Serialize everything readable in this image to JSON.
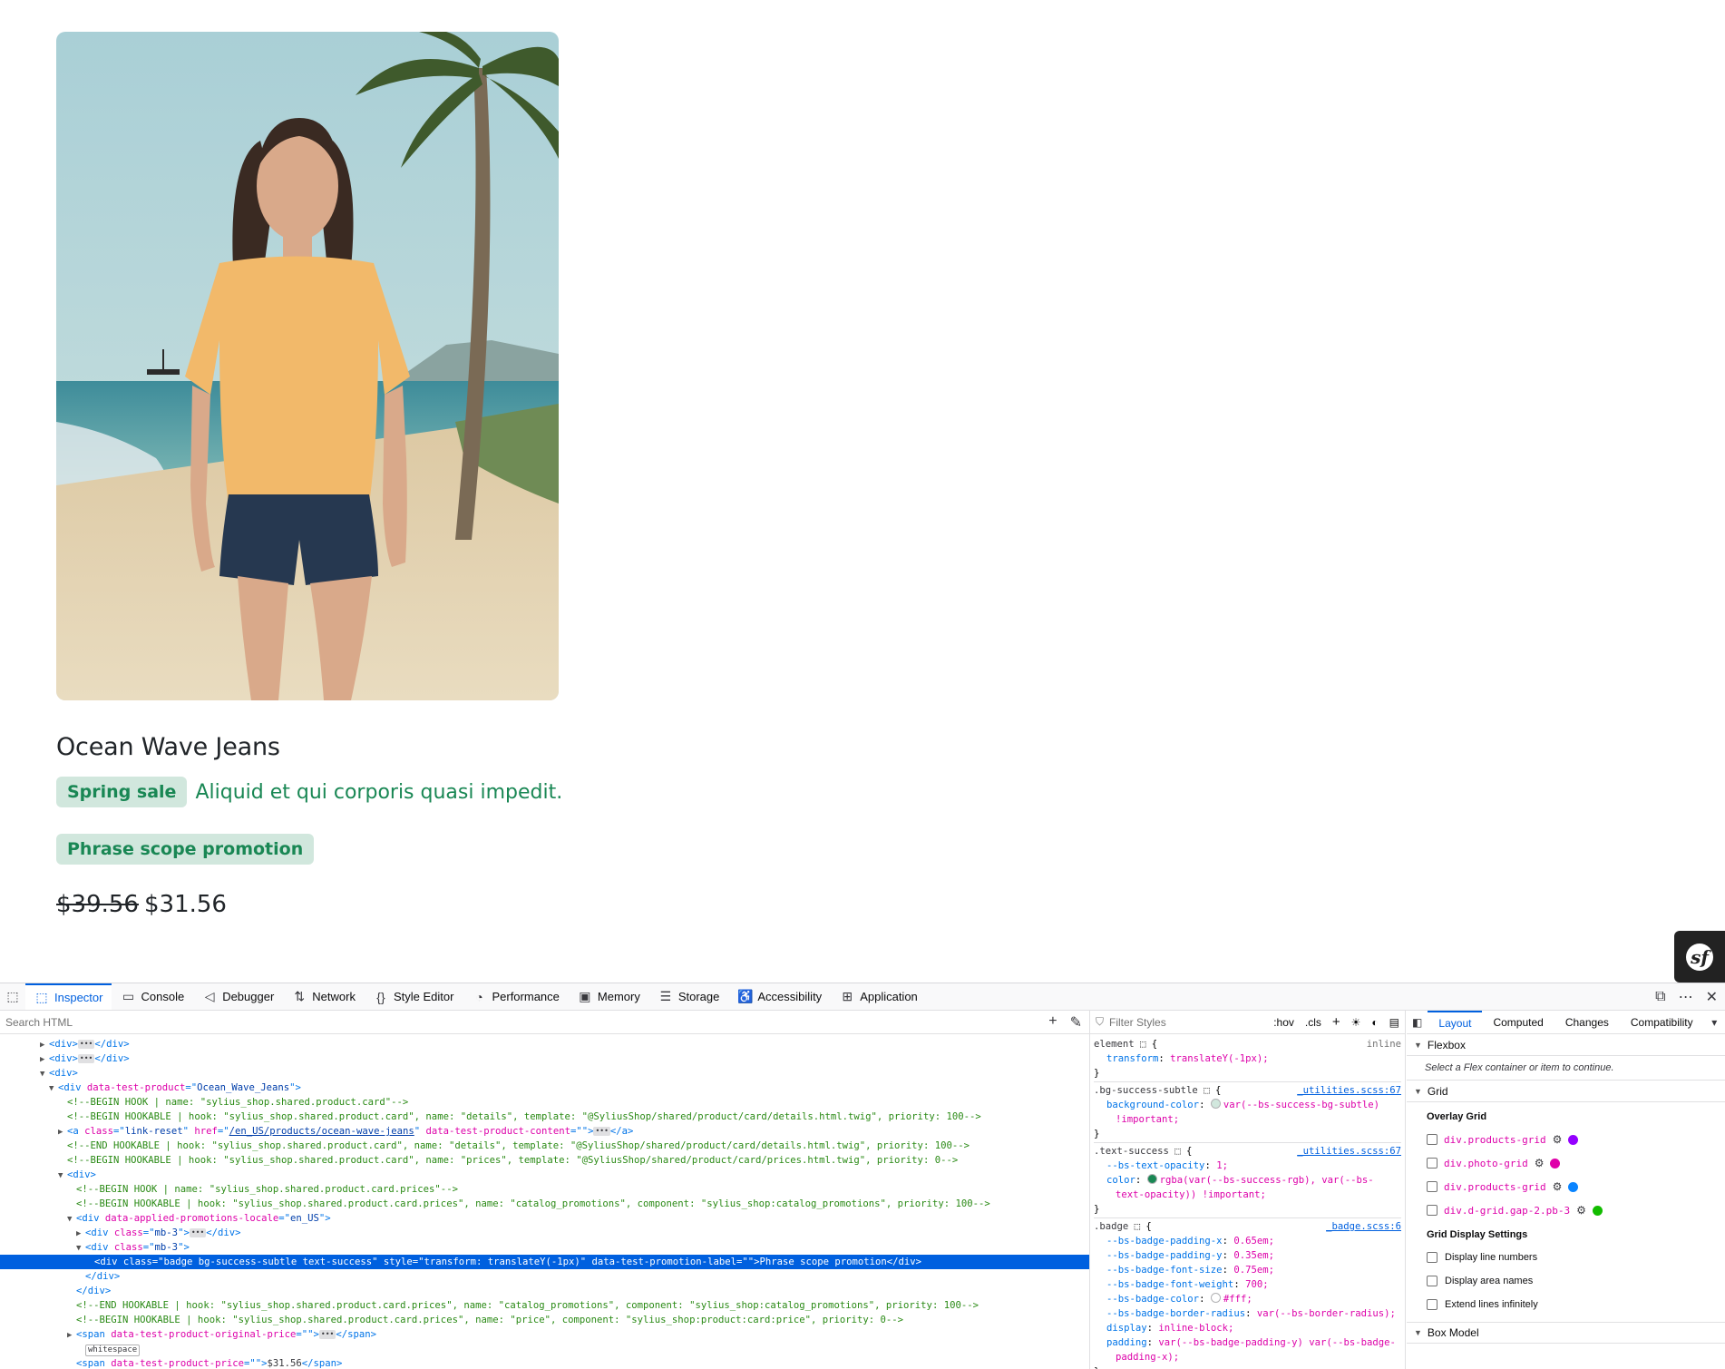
{
  "product": {
    "name": "Ocean Wave Jeans",
    "image_alt": "Woman on beach with palm tree",
    "promotions": [
      {
        "label": "Spring sale",
        "description": "Aliquid et qui corporis quasi impedit."
      },
      {
        "label": "Phrase scope promotion"
      }
    ],
    "original_price": "$39.56",
    "price": "$31.56"
  },
  "symfony_toolbar": {
    "logo": "sf"
  },
  "devtools": {
    "tabs": [
      {
        "label": "Inspector",
        "icon": "inspector-icon"
      },
      {
        "label": "Console",
        "icon": "console-icon"
      },
      {
        "label": "Debugger",
        "icon": "debugger-icon"
      },
      {
        "label": "Network",
        "icon": "network-icon"
      },
      {
        "label": "Style Editor",
        "icon": "style-editor-icon"
      },
      {
        "label": "Performance",
        "icon": "performance-icon"
      },
      {
        "label": "Memory",
        "icon": "memory-icon"
      },
      {
        "label": "Storage",
        "icon": "storage-icon"
      },
      {
        "label": "Accessibility",
        "icon": "accessibility-icon"
      },
      {
        "label": "Application",
        "icon": "application-icon"
      }
    ],
    "search_html_placeholder": "Search HTML",
    "markup_lines": [
      {
        "indent": 5,
        "arrow": "▶",
        "html": "<span class=\"tag\">&lt;div&gt;</span><span class=\"dots\">•••</span><span class=\"tag\">&lt;/div&gt;</span>"
      },
      {
        "indent": 5,
        "arrow": "▶",
        "html": "<span class=\"tag\">&lt;div&gt;</span><span class=\"dots\">•••</span><span class=\"tag\">&lt;/div&gt;</span>"
      },
      {
        "indent": 5,
        "arrow": "▼",
        "html": "<span class=\"tag\">&lt;div&gt;</span>"
      },
      {
        "indent": 6,
        "arrow": "▼",
        "html": "<span class=\"tag\">&lt;div </span><span class=\"attr\">data-test-product</span><span class=\"tag\">=\"</span><span class=\"val\">Ocean_Wave_Jeans</span><span class=\"tag\">\"&gt;</span>"
      },
      {
        "indent": 7,
        "arrow": "",
        "html": "<span class=\"cmt\">&lt;!--BEGIN HOOK | name: \"sylius_shop.shared.product.card\"--&gt;</span>"
      },
      {
        "indent": 7,
        "arrow": "",
        "html": "<span class=\"cmt\">&lt;!--BEGIN HOOKABLE | hook: \"sylius_shop.shared.product.card\", name: \"details\", template: \"@SyliusShop/shared/product/card/details.html.twig\", priority: 100--&gt;</span>"
      },
      {
        "indent": 7,
        "arrow": "▶",
        "html": "<span class=\"tag\">&lt;a </span><span class=\"attr\">class</span><span class=\"tag\">=\"</span><span class=\"val\">link-reset</span><span class=\"tag\">\" </span><span class=\"attr\">href</span><span class=\"tag\">=\"</span><span class=\"val\" style=\"text-decoration:underline\">/en_US/products/ocean-wave-jeans</span><span class=\"tag\">\" </span><span class=\"attr\">data-test-product-content</span><span class=\"tag\">=\"\"&gt;</span><span class=\"dots\">•••</span><span class=\"tag\">&lt;/a&gt;</span>"
      },
      {
        "indent": 7,
        "arrow": "",
        "html": "<span class=\"cmt\">&lt;!--END HOOKABLE | hook: \"sylius_shop.shared.product.card\", name: \"details\", template: \"@SyliusShop/shared/product/card/details.html.twig\", priority: 100--&gt;</span>"
      },
      {
        "indent": 7,
        "arrow": "",
        "html": "<span class=\"cmt\">&lt;!--BEGIN HOOKABLE | hook: \"sylius_shop.shared.product.card\", name: \"prices\", template: \"@SyliusShop/shared/product/card/prices.html.twig\", priority: 0--&gt;</span>"
      },
      {
        "indent": 7,
        "arrow": "▼",
        "html": "<span class=\"tag\">&lt;div&gt;</span>"
      },
      {
        "indent": 8,
        "arrow": "",
        "html": "<span class=\"cmt\">&lt;!--BEGIN HOOK | name: \"sylius_shop.shared.product.card.prices\"--&gt;</span>"
      },
      {
        "indent": 8,
        "arrow": "",
        "html": "<span class=\"cmt\">&lt;!--BEGIN HOOKABLE | hook: \"sylius_shop.shared.product.card.prices\", name: \"catalog_promotions\", component: \"sylius_shop:catalog_promotions\", priority: 100--&gt;</span>"
      },
      {
        "indent": 8,
        "arrow": "▼",
        "html": "<span class=\"tag\">&lt;div </span><span class=\"attr\">data-applied-promotions-locale</span><span class=\"tag\">=\"</span><span class=\"val\">en_US</span><span class=\"tag\">\"&gt;</span>"
      },
      {
        "indent": 9,
        "arrow": "▶",
        "html": "<span class=\"tag\">&lt;div </span><span class=\"attr\">class</span><span class=\"tag\">=\"</span><span class=\"val\">mb-3</span><span class=\"tag\">\"&gt;</span><span class=\"dots\">•••</span><span class=\"tag\">&lt;/div&gt;</span>"
      },
      {
        "indent": 9,
        "arrow": "▼",
        "html": "<span class=\"tag\">&lt;div </span><span class=\"attr\">class</span><span class=\"tag\">=\"</span><span class=\"val\">mb-3</span><span class=\"tag\">\"&gt;</span>"
      },
      {
        "indent": 10,
        "arrow": "",
        "selected": true,
        "html": "<span>&lt;div class=\"badge bg-success-subtle text-success\" style=\"transform: translateY(-1px)\" data-test-promotion-label=\"\"&gt;Phrase scope promotion&lt;/div&gt;</span>"
      },
      {
        "indent": 9,
        "arrow": "",
        "html": "<span class=\"tag\">&lt;/div&gt;</span>"
      },
      {
        "indent": 8,
        "arrow": "",
        "html": "<span class=\"tag\">&lt;/div&gt;</span>"
      },
      {
        "indent": 8,
        "arrow": "",
        "html": "<span class=\"cmt\">&lt;!--END HOOKABLE | hook: \"sylius_shop.shared.product.card.prices\", name: \"catalog_promotions\", component: \"sylius_shop:catalog_promotions\", priority: 100--&gt;</span>"
      },
      {
        "indent": 8,
        "arrow": "",
        "html": "<span class=\"cmt\">&lt;!--BEGIN HOOKABLE | hook: \"sylius_shop.shared.product.card.prices\", name: \"price\", component: \"sylius_shop:product:card:price\", priority: 0--&gt;</span>"
      },
      {
        "indent": 8,
        "arrow": "▶",
        "html": "<span class=\"tag\">&lt;span </span><span class=\"attr\">data-test-product-original-price</span><span class=\"tag\">=\"\"&gt;</span><span class=\"dots\">•••</span><span class=\"tag\">&lt;/span&gt;</span>"
      },
      {
        "indent": 9,
        "arrow": "",
        "html": "<span class=\"ws\">whitespace</span>"
      },
      {
        "indent": 8,
        "arrow": "",
        "html": "<span class=\"tag\">&lt;span </span><span class=\"attr\">data-test-product-price</span><span class=\"tag\">=\"\"&gt;</span><span>$31.56</span><span class=\"tag\">&lt;/span&gt;</span>"
      }
    ],
    "filter_styles_placeholder": "Filter Styles",
    "rules_toolbar": {
      "hov": ":hov",
      "cls": ".cls"
    },
    "rules": [
      {
        "selector": "element",
        "source": "inline",
        "source_link": false,
        "decls": [
          {
            "prop": "transform",
            "value": "translateY(-1px);"
          }
        ]
      },
      {
        "selector": ".bg-success-subtle",
        "source": "_utilities.scss:67",
        "source_link": true,
        "decls": [
          {
            "prop": "background-color",
            "value": "var(--bs-success-bg-subtle) !important;",
            "swatch": "#d1e7dd"
          }
        ]
      },
      {
        "selector": ".text-success",
        "source": "_utilities.scss:67",
        "source_link": true,
        "decls": [
          {
            "prop": "--bs-text-opacity",
            "value": "1;"
          },
          {
            "prop": "color",
            "value": "rgba(var(--bs-success-rgb), var(--bs-text-opacity)) !important;",
            "swatch": "#198754"
          }
        ]
      },
      {
        "selector": ".badge",
        "source": "_badge.scss:6",
        "source_link": true,
        "decls": [
          {
            "prop": "--bs-badge-padding-x",
            "value": "0.65em;"
          },
          {
            "prop": "--bs-badge-padding-y",
            "value": "0.35em;"
          },
          {
            "prop": "--bs-badge-font-size",
            "value": "0.75em;"
          },
          {
            "prop": "--bs-badge-font-weight",
            "value": "700;"
          },
          {
            "prop": "--bs-badge-color",
            "value": "#fff;",
            "swatch": "#ffffff"
          },
          {
            "prop": "--bs-badge-border-radius",
            "value": "var(--bs-border-radius);"
          },
          {
            "prop": "display",
            "value": "inline-block;"
          },
          {
            "prop": "padding",
            "value": "var(--bs-badge-padding-y) var(--bs-badge-padding-x);"
          }
        ]
      }
    ],
    "layout_tabs": [
      "Layout",
      "Computed",
      "Changes",
      "Compatibility"
    ],
    "layout": {
      "flexbox_title": "Flexbox",
      "flexbox_msg": "Select a Flex container or item to continue.",
      "grid_title": "Grid",
      "overlay_grid_title": "Overlay Grid",
      "overlay_grids": [
        {
          "name": "div.products-grid",
          "color": "#9400ff"
        },
        {
          "name": "div.photo-grid",
          "color": "#df00a9"
        },
        {
          "name": "div.products-grid",
          "color": "#0a84ff"
        },
        {
          "name": "div.d-grid.gap-2.pb-3",
          "color": "#12bc00"
        }
      ],
      "grid_display_title": "Grid Display Settings",
      "grid_display_settings": [
        "Display line numbers",
        "Display area names",
        "Extend lines infinitely"
      ],
      "box_model_title": "Box Model"
    }
  }
}
